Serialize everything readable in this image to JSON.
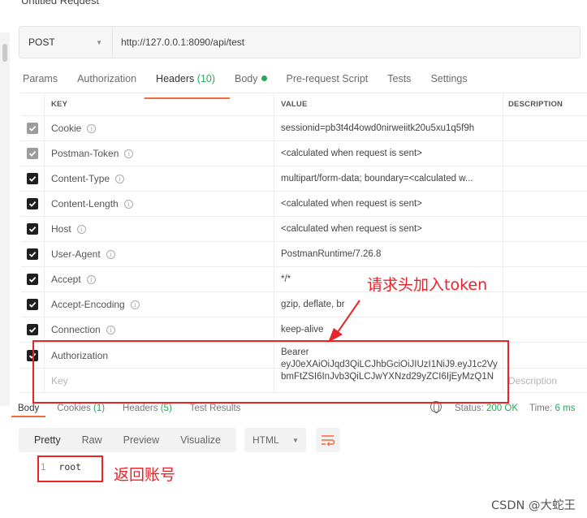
{
  "request": {
    "title": "Untitled Request",
    "method": "POST",
    "url": "http://127.0.0.1:8090/api/test"
  },
  "tabs": [
    {
      "label": "Params"
    },
    {
      "label": "Authorization"
    },
    {
      "label": "Headers",
      "count": "(10)"
    },
    {
      "label": "Body"
    },
    {
      "label": "Pre-request Script"
    },
    {
      "label": "Tests"
    },
    {
      "label": "Settings"
    }
  ],
  "headers_table": {
    "columns": {
      "key": "KEY",
      "value": "VALUE",
      "description": "DESCRIPTION"
    },
    "rows": [
      {
        "key": "Cookie",
        "value": "sessionid=pb3t4d4owd0nirweiitk20u5xu1q5f9h",
        "checked": "dim"
      },
      {
        "key": "Postman-Token",
        "value": "<calculated when request is sent>",
        "checked": "dim"
      },
      {
        "key": "Content-Type",
        "value": "multipart/form-data; boundary=<calculated w...",
        "checked": "on"
      },
      {
        "key": "Content-Length",
        "value": "<calculated when request is sent>",
        "checked": "on"
      },
      {
        "key": "Host",
        "value": "<calculated when request is sent>",
        "checked": "on"
      },
      {
        "key": "User-Agent",
        "value": "PostmanRuntime/7.26.8",
        "checked": "on"
      },
      {
        "key": "Accept",
        "value": "*/*",
        "checked": "on"
      },
      {
        "key": "Accept-Encoding",
        "value": "gzip, deflate, br",
        "checked": "on"
      },
      {
        "key": "Connection",
        "value": "keep-alive",
        "checked": "on"
      }
    ],
    "auth_row": {
      "key": "Authorization",
      "value_line1": "Bearer",
      "value_line2": "eyJ0eXAiOiJqd3QiLCJhbGciOiJIUzI1NiJ9.eyJ1c2Vy",
      "value_line3": "bmFtZSI6InJvb3QiLCJwYXNzd29yZCI6IjEyMzQ1N"
    },
    "new_row": {
      "key_placeholder": "Key",
      "description_placeholder": "Description"
    }
  },
  "response": {
    "tabs": [
      {
        "label": "Body"
      },
      {
        "label": "Cookies",
        "count": "(1)"
      },
      {
        "label": "Headers",
        "count": "(5)"
      },
      {
        "label": "Test Results"
      }
    ],
    "status_label": "Status:",
    "status_value": "200 OK",
    "time_label": "Time:",
    "time_value": "6 ms",
    "view_modes": [
      "Pretty",
      "Raw",
      "Preview",
      "Visualize"
    ],
    "format": "HTML",
    "body_line_number": "1",
    "body_text": "root"
  },
  "annotations": {
    "token_note": "请求头加入token",
    "account_note": "返回账号",
    "color": "#e8232a"
  },
  "watermark": "CSDN @大蛇王"
}
